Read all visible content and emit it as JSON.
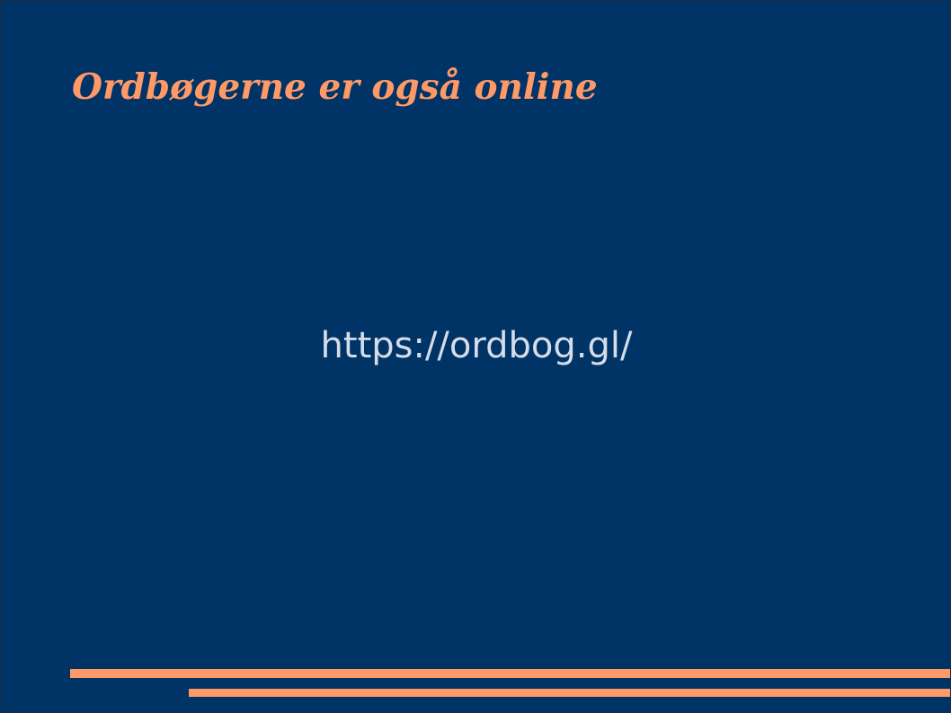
{
  "slide": {
    "title": "Ordbøgerne er også online",
    "url_text": "https://ordbog.gl/"
  },
  "colors": {
    "background": "#003366",
    "title": "#ff9966",
    "body_text": "#d6dce8",
    "stripe": "#ff9966"
  }
}
